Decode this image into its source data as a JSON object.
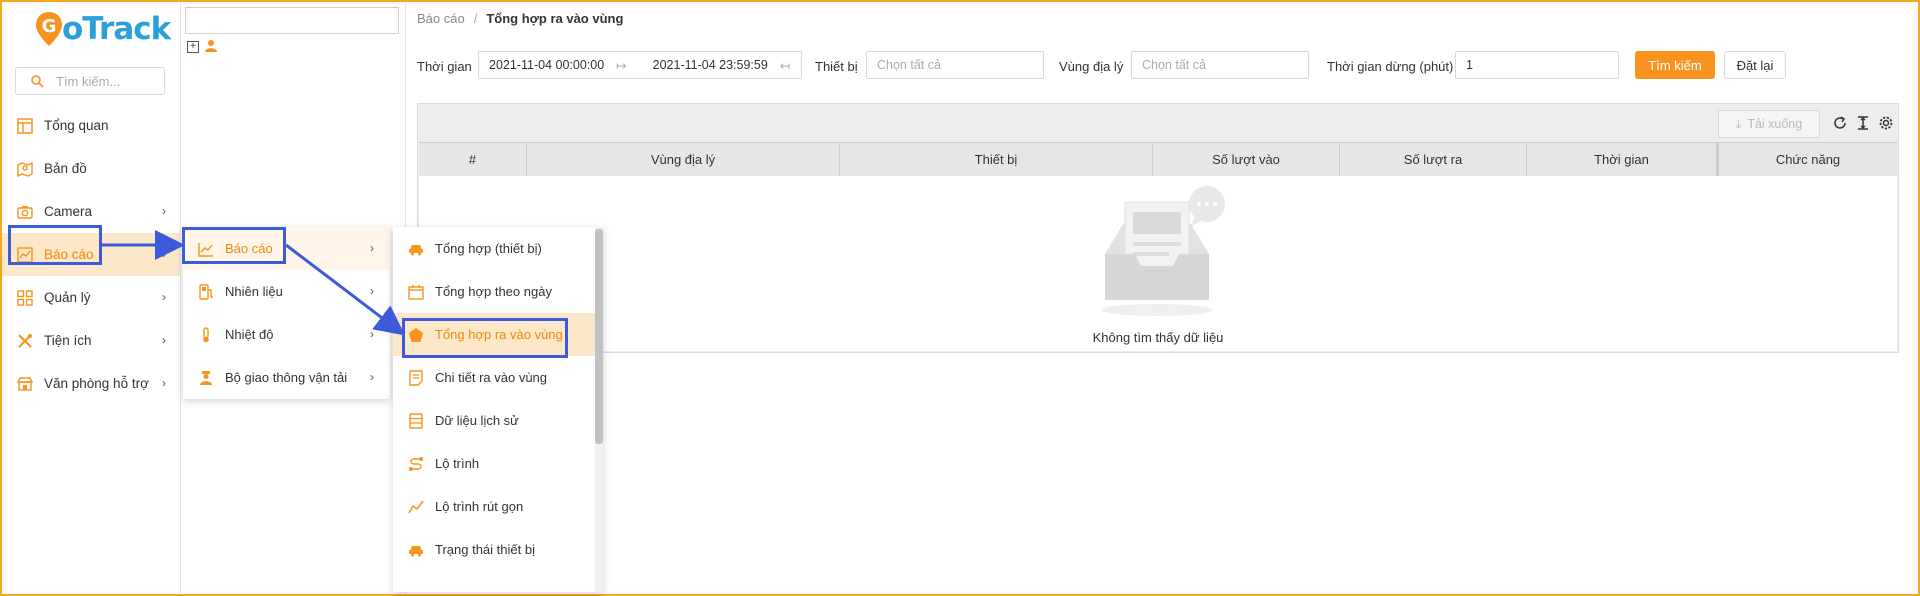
{
  "app": {
    "logo_text": "oTrack",
    "logo_initial": "G",
    "colors": {
      "accent": "#f7931e",
      "brand_blue": "#2ba0d8",
      "highlight": "#3b5bdb",
      "active_bg": "#fde7c9"
    }
  },
  "sidebar": {
    "search_placeholder": "Tìm kiếm...",
    "items": [
      {
        "label": "Tổng quan",
        "icon": "dashboard-icon",
        "has_arrow": false
      },
      {
        "label": "Bản đồ",
        "icon": "map-icon",
        "has_arrow": false
      },
      {
        "label": "Camera",
        "icon": "camera-icon",
        "has_arrow": true
      },
      {
        "label": "Báo cáo",
        "icon": "chart-icon",
        "has_arrow": true,
        "active": true
      },
      {
        "label": "Quản lý",
        "icon": "grid-icon",
        "has_arrow": true
      },
      {
        "label": "Tiện ích",
        "icon": "tools-icon",
        "has_arrow": true
      },
      {
        "label": "Văn phòng hỗ trợ",
        "icon": "store-icon",
        "has_arrow": true
      }
    ],
    "arrow": "›"
  },
  "breadcrumb": {
    "parent": "Báo cáo",
    "separator": "/",
    "current": "Tổng hợp ra vào vùng"
  },
  "filters": {
    "time_label": "Thời gian",
    "time_from": "2021-11-04 00:00:00",
    "time_to": "2021-11-04 23:59:59",
    "device_label": "Thiết bị",
    "device_placeholder": "Chọn tất cả",
    "region_label": "Vùng địa lý",
    "region_placeholder": "Chọn tất cả",
    "stop_label": "Thời gian dừng (phút)",
    "stop_value": "1",
    "search_button": "Tìm kiếm",
    "reset_button": "Đặt lại"
  },
  "grid": {
    "download_label": "Tải xuống",
    "columns": [
      "#",
      "Vùng địa lý",
      "Thiết bị",
      "Số lượt vào",
      "Số lượt ra",
      "Thời gian",
      "Chức năng"
    ],
    "empty_text": "Không tìm thấy dữ liệu"
  },
  "flyout1": {
    "items": [
      {
        "label": "Báo cáo",
        "icon": "line-chart-icon",
        "active": true
      },
      {
        "label": "Nhiên liệu",
        "icon": "fuel-icon"
      },
      {
        "label": "Nhiệt độ",
        "icon": "thermometer-icon"
      },
      {
        "label": "Bộ giao thông vận tải",
        "icon": "officer-icon"
      }
    ]
  },
  "flyout2": {
    "items": [
      {
        "label": "Tổng hợp (thiết bị)",
        "icon": "car-icon"
      },
      {
        "label": "Tổng hợp theo ngày",
        "icon": "calendar-icon"
      },
      {
        "label": "Tổng hợp ra vào vùng",
        "icon": "pentagon-icon",
        "active": true
      },
      {
        "label": "Chi tiết ra vào vùng",
        "icon": "document-icon"
      },
      {
        "label": "Dữ liệu lịch sử",
        "icon": "list-icon"
      },
      {
        "label": "Lộ trình",
        "icon": "route-icon"
      },
      {
        "label": "Lộ trình rút gọn",
        "icon": "trend-icon"
      },
      {
        "label": "Trạng thái thiết bị",
        "icon": "car-icon"
      }
    ]
  }
}
